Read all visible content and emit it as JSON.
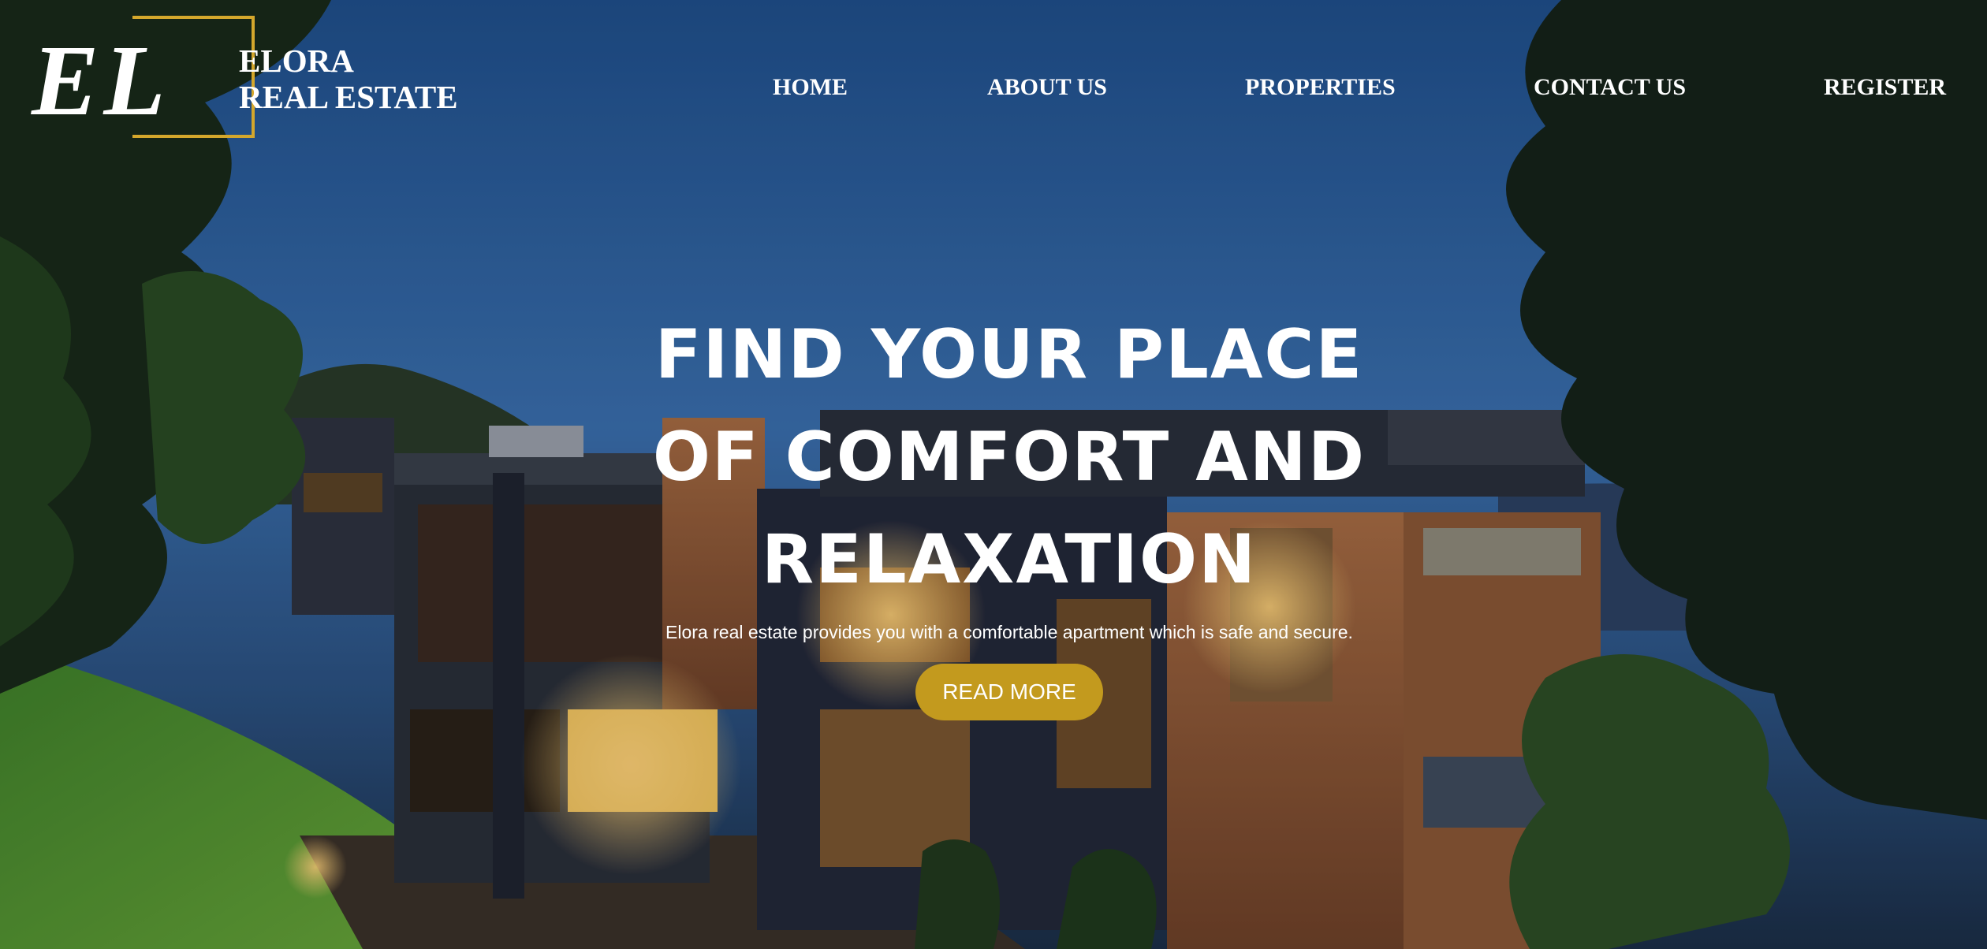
{
  "brand": {
    "logo_letters": "EL",
    "name_line1": "ELORA",
    "name_line2": "REAL ESTATE",
    "accent_color": "#d4a72c"
  },
  "nav": {
    "items": [
      {
        "label": "HOME"
      },
      {
        "label": "ABOUT US"
      },
      {
        "label": "PROPERTIES"
      },
      {
        "label": "CONTACT US"
      },
      {
        "label": "REGISTER"
      }
    ]
  },
  "hero": {
    "title_line1": "FIND YOUR PLACE",
    "title_line2": "OF COMFORT AND",
    "title_line3": "RELAXATION",
    "subtitle": "Elora real estate provides you with a comfortable apartment which is safe and secure.",
    "button_label": "READ MORE",
    "button_color": "#c39a1e"
  }
}
